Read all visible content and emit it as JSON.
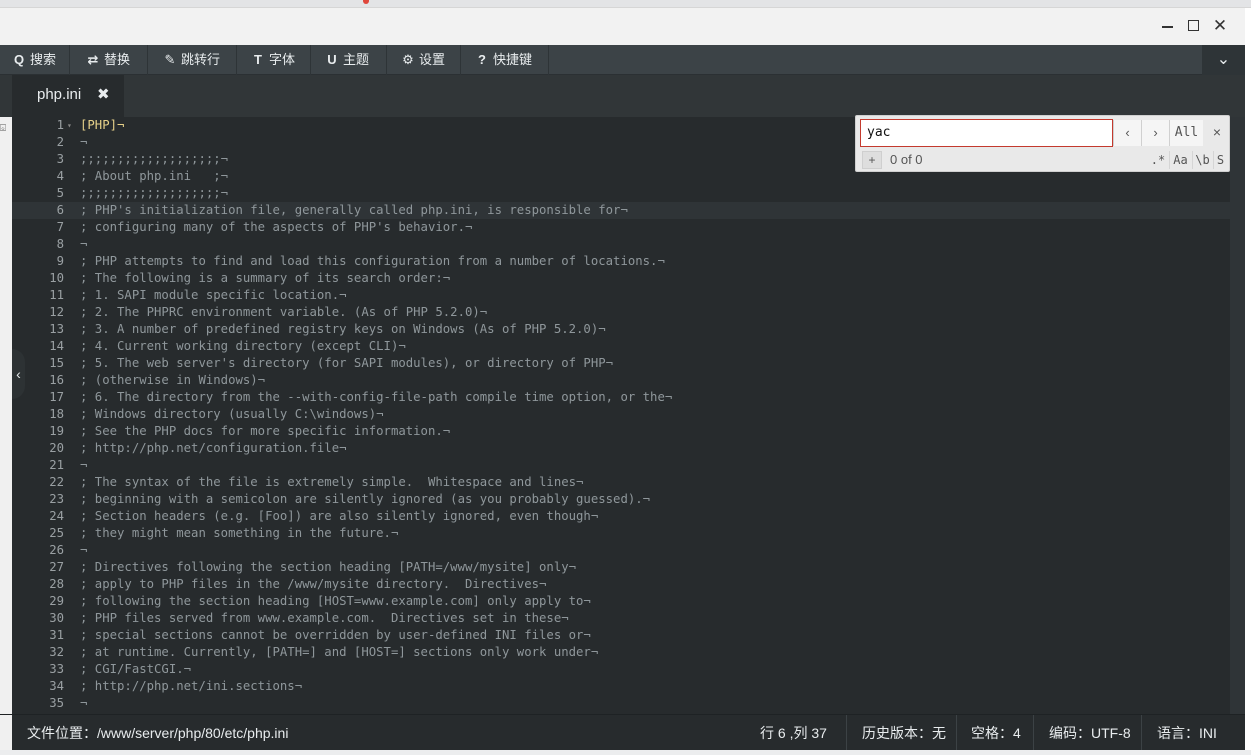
{
  "toolbar": {
    "items": [
      {
        "icon": "Q",
        "label": "搜索"
      },
      {
        "icon": "⇄",
        "label": "替换"
      },
      {
        "icon": "✎",
        "label": "跳转行"
      },
      {
        "icon": "T",
        "label": "字体"
      },
      {
        "icon": "U",
        "label": "主题"
      },
      {
        "icon": "⚙",
        "label": "设置"
      },
      {
        "icon": "?",
        "label": "快捷键"
      }
    ]
  },
  "icons": {
    "search": "magnifier-icon",
    "replace": "swap-icon",
    "goto": "pin-icon",
    "font": "text-icon",
    "theme": "magnet-icon",
    "settings": "gear-icon",
    "help": "question-icon"
  },
  "tab": {
    "label": "php.ini",
    "close_glyph": "✖"
  },
  "search": {
    "value": "yac",
    "prev_glyph": "‹",
    "next_glyph": "›",
    "all_label": "All",
    "close_glyph": "×",
    "add_glyph": "+",
    "count": "0 of 0",
    "options": [
      ".*",
      "Aa",
      "\\b",
      "S"
    ]
  },
  "editor": {
    "active_line": 6,
    "lines": [
      "[PHP]¬",
      "¬",
      ";;;;;;;;;;;;;;;;;;;¬",
      "; About php.ini   ;¬",
      ";;;;;;;;;;;;;;;;;;;¬",
      "; PHP's initialization file, generally called php.ini, is responsible for¬",
      "; configuring many of the aspects of PHP's behavior.¬",
      "¬",
      "; PHP attempts to find and load this configuration from a number of locations.¬",
      "; The following is a summary of its search order:¬",
      "; 1. SAPI module specific location.¬",
      "; 2. The PHPRC environment variable. (As of PHP 5.2.0)¬",
      "; 3. A number of predefined registry keys on Windows (As of PHP 5.2.0)¬",
      "; 4. Current working directory (except CLI)¬",
      "; 5. The web server's directory (for SAPI modules), or directory of PHP¬",
      "; (otherwise in Windows)¬",
      "; 6. The directory from the --with-config-file-path compile time option, or the¬",
      "; Windows directory (usually C:\\windows)¬",
      "; See the PHP docs for more specific information.¬",
      "; http://php.net/configuration.file¬",
      "¬",
      "; The syntax of the file is extremely simple.  Whitespace and lines¬",
      "; beginning with a semicolon are silently ignored (as you probably guessed).¬",
      "; Section headers (e.g. [Foo]) are also silently ignored, even though¬",
      "; they might mean something in the future.¬",
      "¬",
      "; Directives following the section heading [PATH=/www/mysite] only¬",
      "; apply to PHP files in the /www/mysite directory.  Directives¬",
      "; following the section heading [HOST=www.example.com] only apply to¬",
      "; PHP files served from www.example.com.  Directives set in these¬",
      "; special sections cannot be overridden by user-defined INI files or¬",
      "; at runtime. Currently, [PATH=] and [HOST=] sections only work under¬",
      "; CGI/FastCGI.¬",
      "; http://php.net/ini.sections¬",
      "¬"
    ]
  },
  "statusbar": {
    "path": "文件位置：/www/server/php/80/etc/php.ini",
    "position": "行 6 ,列 37",
    "history": "历史版本：无",
    "indent": "空格：4",
    "encoding": "编码：UTF-8",
    "language": "语言：INI"
  },
  "colors": {
    "editor_bg": "#272b2d",
    "toolbar_bg": "#3c4347",
    "search_border": "#c43a2e",
    "section_color": "#e7d28a"
  }
}
